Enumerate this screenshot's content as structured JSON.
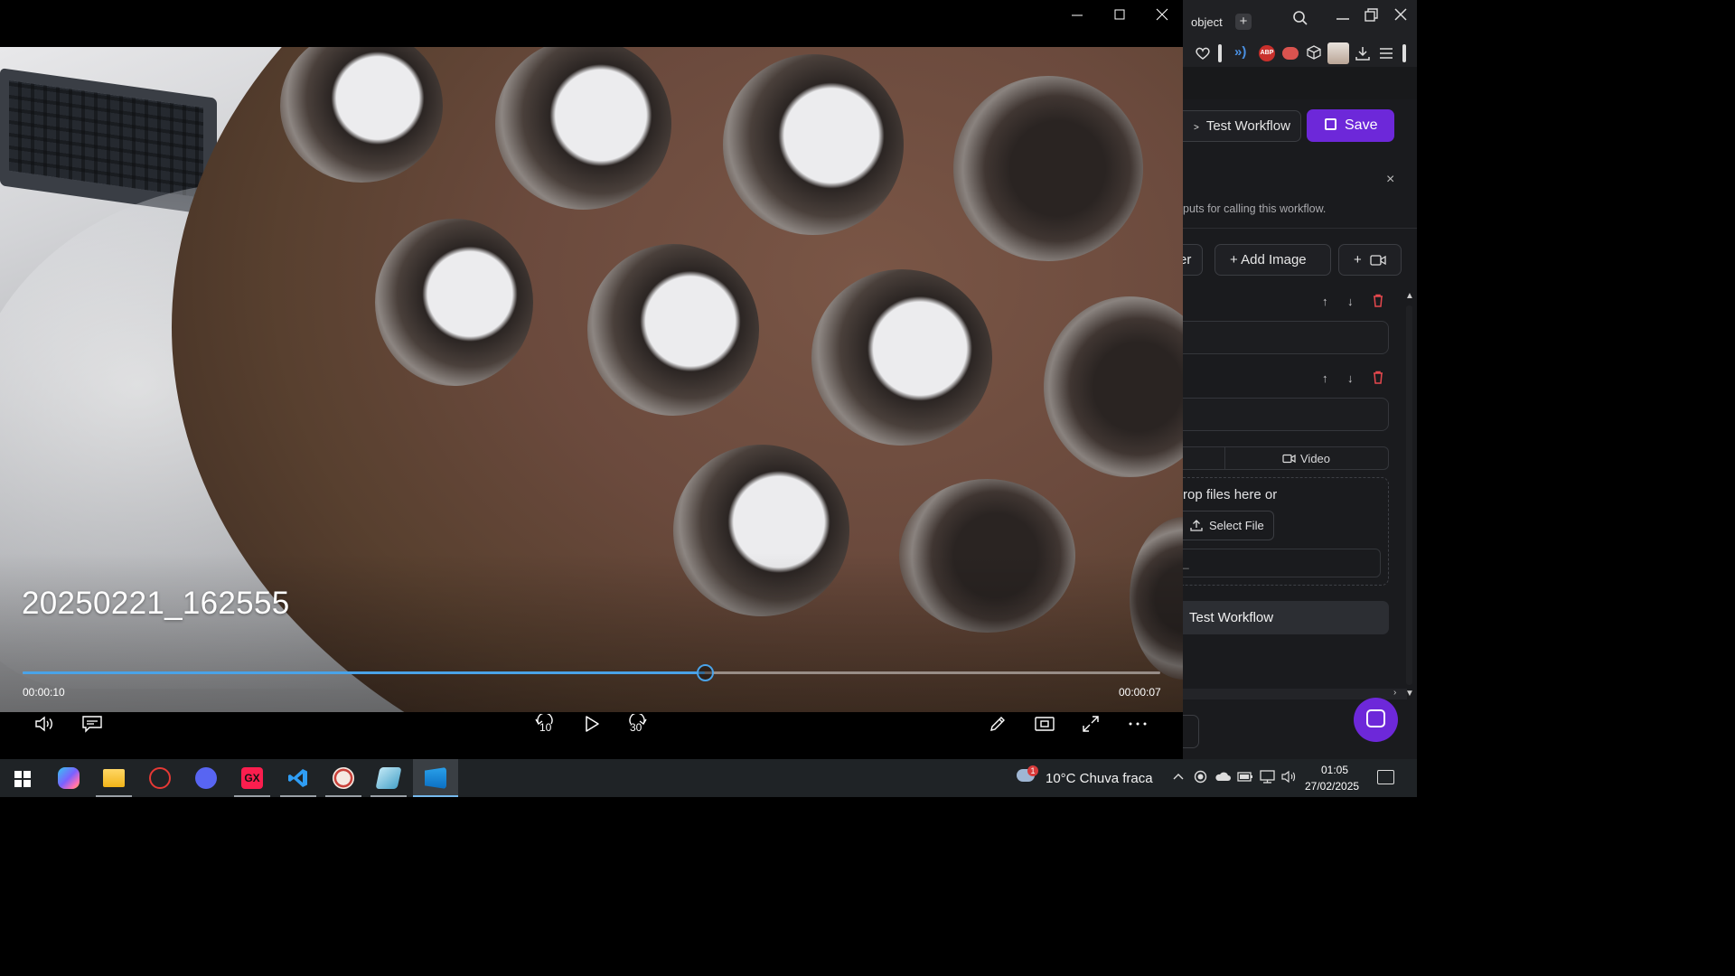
{
  "browser": {
    "tab_label": "object",
    "new_tab": "+",
    "test_workflow_top": "Test Workflow",
    "save_label": "Save",
    "close_glyph": "×",
    "panel_desc": "puts for calling this workflow.",
    "chip_partial": "er",
    "add_image": "+ Add Image",
    "add_video": "+",
    "tab_video": "Video",
    "drop_text": "rop files here or",
    "select_file": "Select File",
    "inner_field": "_",
    "test_workflow_bottom": "Test Workflow",
    "extension_badge": "ABP"
  },
  "player": {
    "title": "20250221_162555",
    "elapsed": "00:00:10",
    "remaining": "00:00:07",
    "progress": 0.6,
    "skip_back": "10",
    "skip_forward": "30"
  },
  "taskbar": {
    "apps": [
      "start",
      "copilot-icon",
      "file-explorer-icon",
      "app-red-icon",
      "discord-icon",
      "opera-gx-icon",
      "vscode-icon",
      "app-mascot-icon",
      "app-blue-icon",
      "media-player-icon"
    ],
    "gx_label": "GX",
    "weather_badge": "1",
    "weather": "10°C  Chuva fraca",
    "time": "01:05",
    "date": "27/02/2025"
  },
  "colors": {
    "accent": "#6d28d9",
    "seek": "#4aa3e8",
    "taskbar": "#1f2326"
  }
}
